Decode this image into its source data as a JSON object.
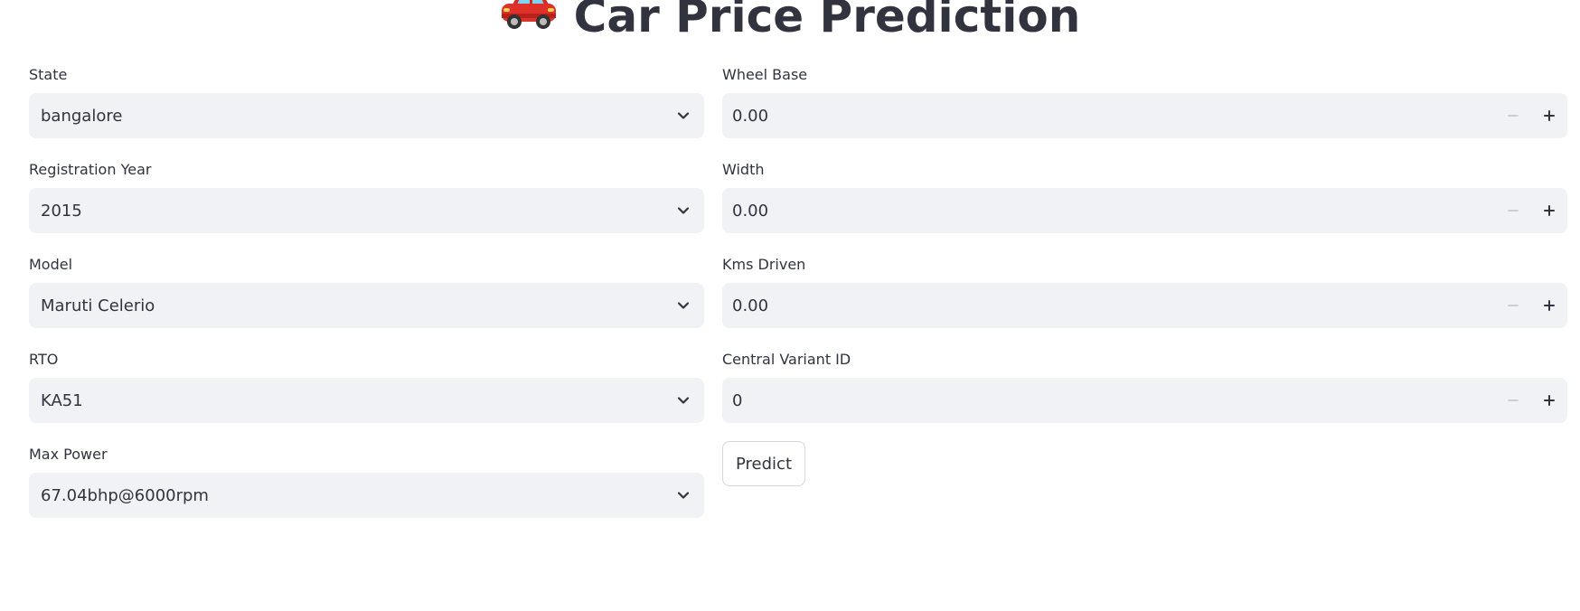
{
  "page": {
    "title": "Car Price Prediction",
    "title_icon": "car-emoji-icon"
  },
  "left_fields": [
    {
      "label": "State",
      "value": "bangalore"
    },
    {
      "label": "Registration Year",
      "value": "2015"
    },
    {
      "label": "Model",
      "value": "Maruti Celerio"
    },
    {
      "label": "RTO",
      "value": "KA51"
    },
    {
      "label": "Max Power",
      "value": "67.04bhp@6000rpm"
    }
  ],
  "right_fields": [
    {
      "label": "Wheel Base",
      "value": "0.00"
    },
    {
      "label": "Width",
      "value": "0.00"
    },
    {
      "label": "Kms Driven",
      "value": "0.00"
    },
    {
      "label": "Central Variant ID",
      "value": "0"
    }
  ],
  "predict_button": {
    "label": "Predict"
  },
  "colors": {
    "text": "#31333f",
    "input_background": "#f0f2f6",
    "button_border": "#d5d6da",
    "disabled_icon": "#c7c9cf",
    "car_red": "#e0302a"
  }
}
